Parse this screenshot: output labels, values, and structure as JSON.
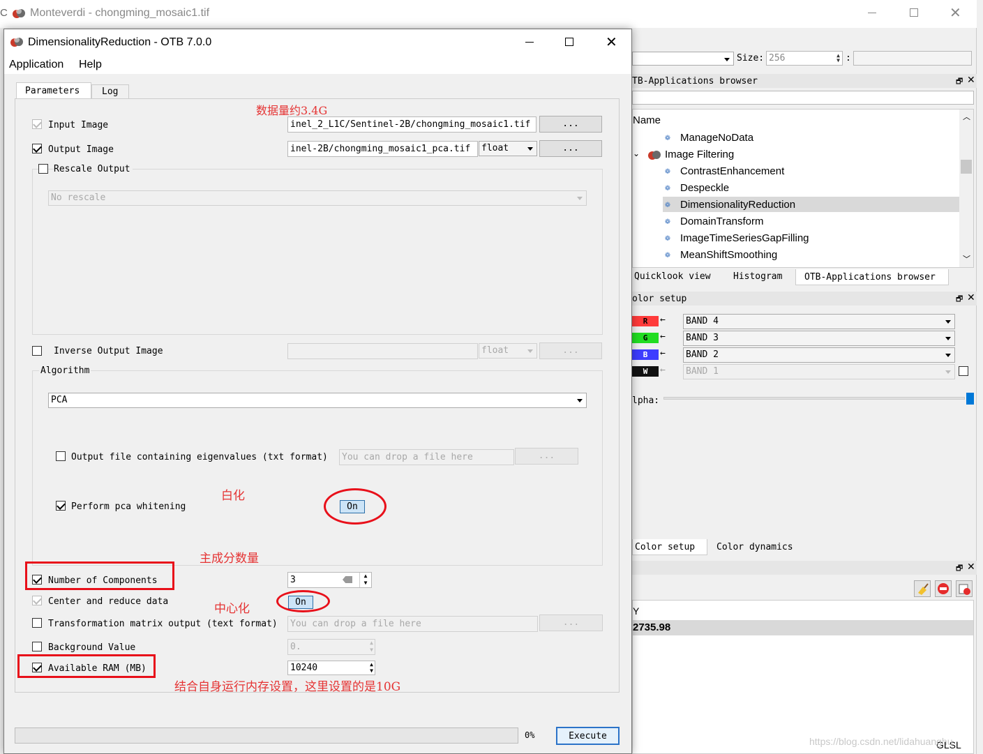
{
  "main_window": {
    "title": "Monteverdi - chongming_mosaic1.tif",
    "size_label": "Size:",
    "size_value": "256",
    "colon": ":"
  },
  "apps_browser": {
    "title": "TB-Applications browser",
    "column_header": "Name",
    "items": [
      "ManageNoData",
      "Image Filtering",
      "ContrastEnhancement",
      "Despeckle",
      "DimensionalityReduction",
      "DomainTransform",
      "ImageTimeSeriesGapFilling",
      "MeanShiftSmoothing"
    ],
    "tabs": [
      "Quicklook view",
      "Histogram",
      "OTB-Applications browser"
    ]
  },
  "color_setup": {
    "title": "olor setup",
    "bands": [
      {
        "channel": "R",
        "value": "BAND 4",
        "color": "#ff3b3b"
      },
      {
        "channel": "G",
        "value": "BAND 3",
        "color": "#22dd22"
      },
      {
        "channel": "B",
        "value": "BAND 2",
        "color": "#3d3dff"
      },
      {
        "channel": "W",
        "value": "BAND 1",
        "color": "#111111"
      }
    ],
    "alpha_label": "lpha:",
    "tabs": [
      "Color setup",
      "Color dynamics"
    ]
  },
  "pixel_panel": {
    "column_header": "Y",
    "value": "2735.98",
    "glsl": "GLSL"
  },
  "watermark": "https://blog.csdn.net/lidahuanghu",
  "dialog": {
    "title": "DimensionalityReduction - OTB 7.0.0",
    "menu": [
      "Application",
      "Help"
    ],
    "tabs": [
      "Parameters",
      "Log"
    ],
    "input_image": {
      "label": "Input Image",
      "value": "inel_2_L1C/Sentinel-2B/chongming_mosaic1.tif",
      "browse": "..."
    },
    "output_image": {
      "label": "Output Image",
      "value": "inel-2B/chongming_mosaic1_pca.tif",
      "type": "float",
      "browse": "..."
    },
    "rescale_output": {
      "label": "Rescale Output",
      "value": "No rescale"
    },
    "inverse_output": {
      "label": "Inverse Output Image",
      "type": "float",
      "browse": "..."
    },
    "algorithm": {
      "label": "Algorithm",
      "value": "PCA"
    },
    "eigen_output": {
      "label": "Output file containing eigenvalues (txt format)",
      "placeholder": "You can drop a file here",
      "browse": "..."
    },
    "whitening": {
      "label": "Perform pca whitening",
      "value": "On"
    },
    "components": {
      "label": "Number of Components",
      "value": "3"
    },
    "center_reduce": {
      "label": "Center and reduce data",
      "value": "On"
    },
    "transform_matrix": {
      "label": "Transformation matrix output (text format)",
      "placeholder": "You can drop a file here",
      "browse": "..."
    },
    "background": {
      "label": "Background Value",
      "value": "0."
    },
    "ram": {
      "label": "Available RAM (MB)",
      "value": "10240"
    },
    "progress": {
      "percent_label": "0%",
      "value": 0
    },
    "execute": "Execute"
  },
  "annotations": {
    "data_size": "数据量约3.4G",
    "whitening": "白化",
    "components": "主成分数量",
    "centering": "中心化",
    "ram": "结合自身运行内存设置，这里设置的是10G"
  }
}
